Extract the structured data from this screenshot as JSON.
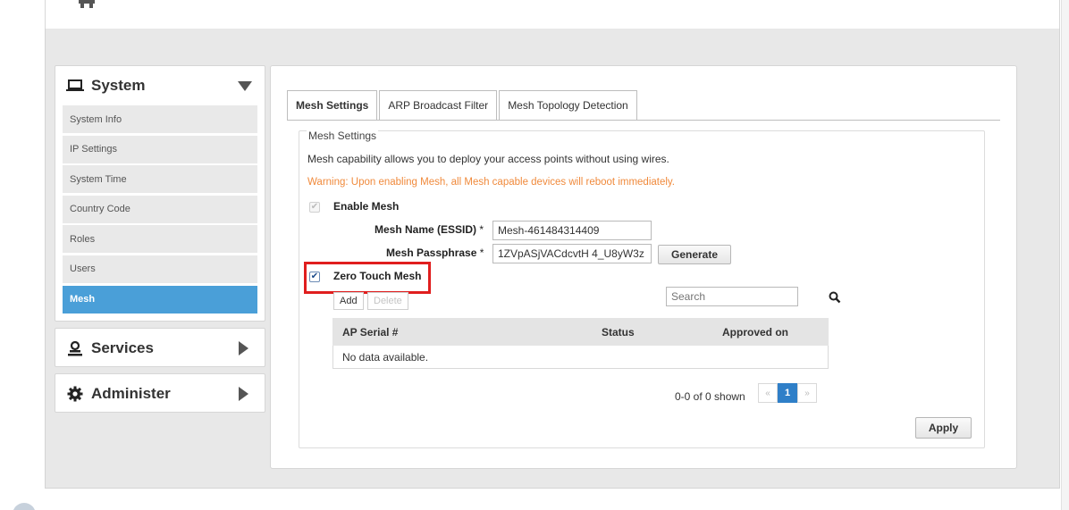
{
  "sidebar": {
    "system": {
      "title": "System",
      "items": [
        {
          "label": "System Info",
          "active": false
        },
        {
          "label": "IP Settings",
          "active": false
        },
        {
          "label": "System Time",
          "active": false
        },
        {
          "label": "Country Code",
          "active": false
        },
        {
          "label": "Roles",
          "active": false
        },
        {
          "label": "Users",
          "active": false
        },
        {
          "label": "Mesh",
          "active": true
        }
      ]
    },
    "services": {
      "title": "Services"
    },
    "administer": {
      "title": "Administer"
    }
  },
  "tabs": [
    {
      "label": "Mesh Settings",
      "active": true
    },
    {
      "label": "ARP Broadcast Filter",
      "active": false
    },
    {
      "label": "Mesh Topology Detection",
      "active": false
    }
  ],
  "mesh": {
    "legend": "Mesh Settings",
    "description": "Mesh capability allows you to deploy your access points without using wires.",
    "warning": "Warning: Upon enabling Mesh, all Mesh capable devices will reboot immediately.",
    "enable_label": "Enable Mesh",
    "enable_checked": true,
    "name_label": "Mesh Name (ESSID)",
    "name_value": "Mesh-461484314409",
    "passphrase_label": "Mesh Passphrase",
    "passphrase_value": "1ZVpASjVACdcvtH 4_U8yW3z",
    "required_mark": "*",
    "generate_label": "Generate",
    "ztm_label": "Zero Touch Mesh",
    "ztm_checked": true,
    "add_label": "Add",
    "delete_label": "Delete",
    "search_placeholder": "Search",
    "table": {
      "headers": [
        "AP Serial #",
        "Status",
        "Approved on"
      ],
      "empty_text": "No data available."
    },
    "shown_text": "0-0 of 0 shown",
    "pager": {
      "prev": "«",
      "current": "1",
      "next": "»"
    },
    "apply_label": "Apply"
  },
  "colors": {
    "accent": "#4a9fd8",
    "warning": "#f08a3c",
    "highlight": "#e01e1e",
    "pager_active": "#2f7fc8"
  }
}
